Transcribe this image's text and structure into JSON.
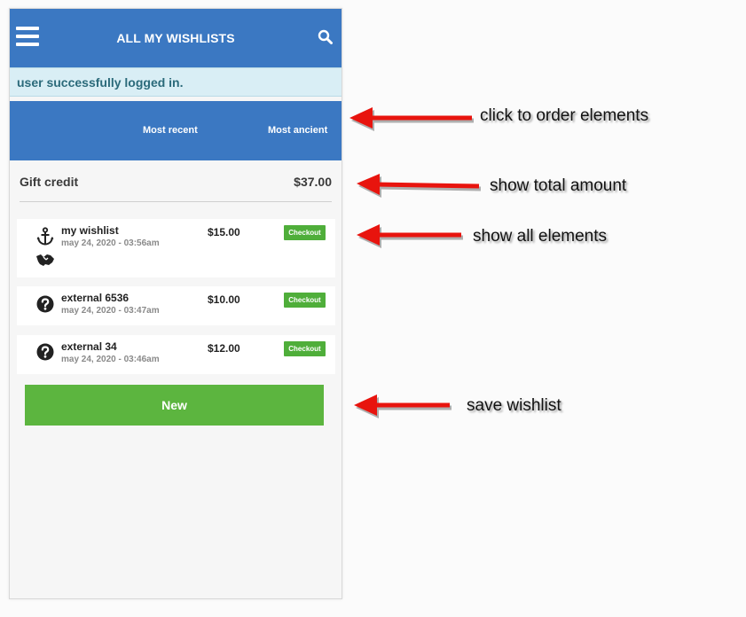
{
  "header": {
    "title": "ALL MY WISHLISTS",
    "menu_icon": "hamburger-menu-icon",
    "search_icon": "search-icon"
  },
  "alert": {
    "message": "user successfully logged in."
  },
  "sort": {
    "most_recent": "Most recent",
    "most_ancient": "Most ancient"
  },
  "credit": {
    "label": "Gift credit",
    "amount": "$37.00"
  },
  "wishlists": [
    {
      "name": "my wishlist",
      "date": "may 24, 2020 - 03:56am",
      "price": "$15.00",
      "checkout": "Checkout",
      "icons": [
        "anchor-icon",
        "handshake-icon"
      ]
    },
    {
      "name": "external 6536",
      "date": "may 24, 2020 - 03:47am",
      "price": "$10.00",
      "checkout": "Checkout",
      "icons": [
        "question-circle-icon"
      ]
    },
    {
      "name": "external 34",
      "date": "may 24, 2020 - 03:46am",
      "price": "$12.00",
      "checkout": "Checkout",
      "icons": [
        "question-circle-icon"
      ]
    }
  ],
  "new_button": {
    "label": "New"
  },
  "annotations": {
    "order": "click to order elements",
    "total": "show total amount",
    "all": "show all elements",
    "save": "save wishlist"
  },
  "colors": {
    "header_blue": "#3b78c2",
    "checkout_green": "#4fae3a",
    "new_green": "#5cb53f",
    "alert_bg": "#d9eef5",
    "arrow_red": "#e8140e"
  }
}
